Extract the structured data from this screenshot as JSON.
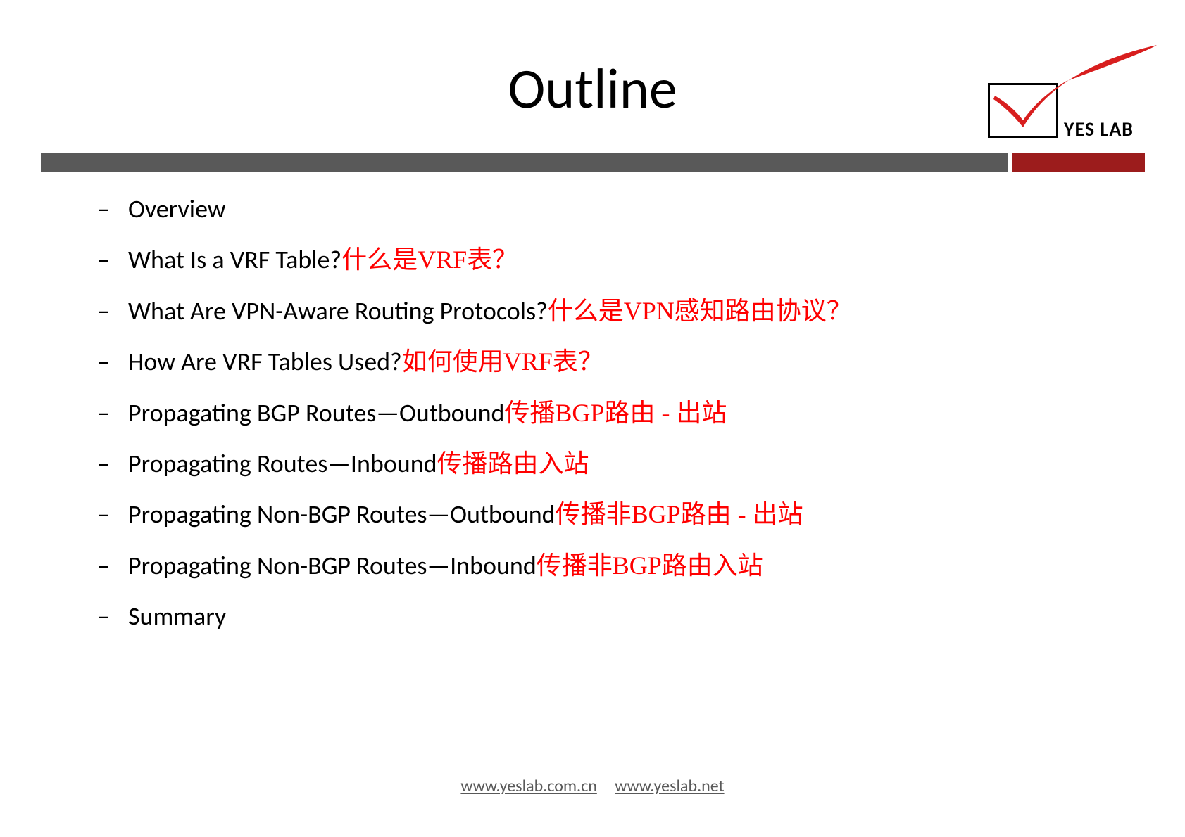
{
  "title": "Outline",
  "logo": {
    "text": "YES LAB"
  },
  "items": [
    {
      "en": "Overview",
      "zh": ""
    },
    {
      "en": "What Is a VRF Table?",
      "zh": "什么是VRF表？"
    },
    {
      "en": "What Are VPN-Aware Routing Protocols?",
      "zh": "什么是VPN感知路由协议？"
    },
    {
      "en": "How Are VRF Tables Used?",
      "zh": "如何使用VRF表？"
    },
    {
      "en": "Propagating BGP Routes—Outbound",
      "zh": "传播BGP路由 - 出站"
    },
    {
      "en": "Propagating Routes—Inbound",
      "zh": "传播路由入站"
    },
    {
      "en": "Propagating Non-BGP Routes—Outbound",
      "zh": "传播非BGP路由 - 出站"
    },
    {
      "en": "Propagating Non-BGP Routes—Inbound",
      "zh": "传播非BGP路由入站"
    },
    {
      "en": "Summary",
      "zh": ""
    }
  ],
  "footer": {
    "link1": "www.yeslab.com.cn",
    "link2": "www.yeslab.net"
  },
  "colors": {
    "red": "#ff0000",
    "darkred": "#9c1c1c",
    "gray": "#595959"
  }
}
